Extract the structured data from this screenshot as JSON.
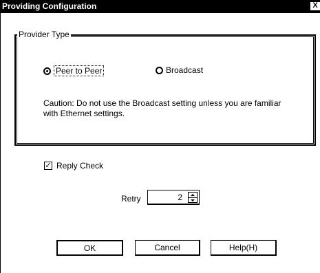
{
  "window": {
    "title": "Providing Configuration",
    "close_label": "X"
  },
  "provider_type": {
    "group_label": "Provider Type",
    "options": [
      {
        "label": "Peer to Peer",
        "selected": true
      },
      {
        "label": "Broadcast",
        "selected": false
      }
    ],
    "caution": "Caution: Do not use the Broadcast setting unless you are familiar with Ethernet settings."
  },
  "reply_check": {
    "label": "Reply Check",
    "checked": true
  },
  "retry": {
    "label": "Retry",
    "value": "2"
  },
  "buttons": {
    "ok": "OK",
    "cancel": "Cancel",
    "help": "Help(H)"
  }
}
